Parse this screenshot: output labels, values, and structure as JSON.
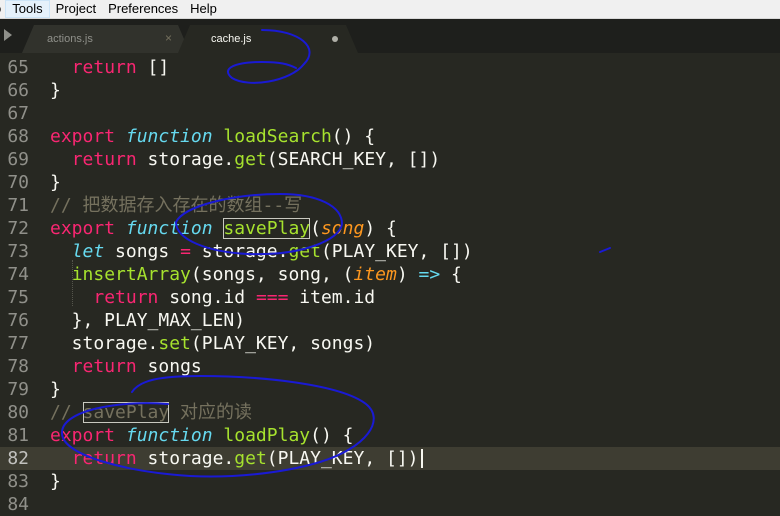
{
  "menu": {
    "items": [
      {
        "label": "o"
      },
      {
        "label": "Tools"
      },
      {
        "label": "Project"
      },
      {
        "label": "Preferences"
      },
      {
        "label": "Help"
      }
    ]
  },
  "tabs": [
    {
      "label": "actions.js",
      "close_glyph": "×"
    },
    {
      "label": "cache.js"
    }
  ],
  "editor": {
    "lines": [
      {
        "num": "65",
        "segments": [
          {
            "t": "  "
          },
          {
            "t": "return",
            "c": "kw"
          },
          {
            "t": " []"
          }
        ]
      },
      {
        "num": "66",
        "segments": [
          {
            "t": "}"
          }
        ]
      },
      {
        "num": "67",
        "segments": []
      },
      {
        "num": "68",
        "segments": [
          {
            "t": "export",
            "c": "kw"
          },
          {
            "t": " "
          },
          {
            "t": "function",
            "c": "st"
          },
          {
            "t": " "
          },
          {
            "t": "loadSearch",
            "c": "fn"
          },
          {
            "t": "() {"
          }
        ]
      },
      {
        "num": "69",
        "segments": [
          {
            "t": "  "
          },
          {
            "t": "return",
            "c": "kw"
          },
          {
            "t": " storage."
          },
          {
            "t": "get",
            "c": "fn"
          },
          {
            "t": "(SEARCH_KEY, [])"
          }
        ]
      },
      {
        "num": "70",
        "segments": [
          {
            "t": "}"
          }
        ]
      },
      {
        "num": "71",
        "segments": [
          {
            "t": "// 把数据存入存在的数组--写",
            "c": "cm"
          }
        ]
      },
      {
        "num": "72",
        "segments": [
          {
            "t": "export",
            "c": "kw"
          },
          {
            "t": " "
          },
          {
            "t": "function",
            "c": "st"
          },
          {
            "t": " "
          },
          {
            "t": "savePlay",
            "c": "fn hl"
          },
          {
            "t": "("
          },
          {
            "t": "song",
            "c": "pa"
          },
          {
            "t": ") {"
          }
        ]
      },
      {
        "num": "73",
        "segments": [
          {
            "t": "  "
          },
          {
            "t": "let",
            "c": "st"
          },
          {
            "t": " songs "
          },
          {
            "t": "=",
            "c": "kw"
          },
          {
            "t": " storage."
          },
          {
            "t": "get",
            "c": "fn"
          },
          {
            "t": "(PLAY_KEY, [])"
          }
        ]
      },
      {
        "num": "74",
        "segments": [
          {
            "t": "  "
          },
          {
            "t": "insertArray",
            "c": "fn"
          },
          {
            "t": "(songs, song, ("
          },
          {
            "t": "item",
            "c": "pa"
          },
          {
            "t": ") "
          },
          {
            "t": "=>",
            "c": "st"
          },
          {
            "t": " {"
          }
        ]
      },
      {
        "num": "75",
        "segments": [
          {
            "t": "    "
          },
          {
            "t": "return",
            "c": "kw"
          },
          {
            "t": " song.id "
          },
          {
            "t": "===",
            "c": "kw"
          },
          {
            "t": " item.id"
          }
        ]
      },
      {
        "num": "76",
        "segments": [
          {
            "t": "  }, PLAY_MAX_LEN)"
          }
        ]
      },
      {
        "num": "77",
        "segments": [
          {
            "t": "  storage."
          },
          {
            "t": "set",
            "c": "fn"
          },
          {
            "t": "(PLAY_KEY, songs)"
          }
        ]
      },
      {
        "num": "78",
        "segments": [
          {
            "t": "  "
          },
          {
            "t": "return",
            "c": "kw"
          },
          {
            "t": " songs"
          }
        ]
      },
      {
        "num": "79",
        "segments": [
          {
            "t": "}"
          }
        ]
      },
      {
        "num": "80",
        "segments": [
          {
            "t": "// ",
            "c": "cm"
          },
          {
            "t": "savePlay",
            "c": "cm hl"
          },
          {
            "t": " 对应的读",
            "c": "cm"
          }
        ]
      },
      {
        "num": "81",
        "segments": [
          {
            "t": "export",
            "c": "kw"
          },
          {
            "t": " "
          },
          {
            "t": "function",
            "c": "st"
          },
          {
            "t": " "
          },
          {
            "t": "loadPlay",
            "c": "fn"
          },
          {
            "t": "() {"
          }
        ]
      },
      {
        "num": "82",
        "current": true,
        "segments": [
          {
            "t": "  "
          },
          {
            "t": "return",
            "c": "kw"
          },
          {
            "t": " storage."
          },
          {
            "t": "get",
            "c": "fn"
          },
          {
            "t": "(PLAY_KEY, [])"
          }
        ]
      },
      {
        "num": "83",
        "segments": [
          {
            "t": "}"
          }
        ]
      },
      {
        "num": "84",
        "segments": []
      }
    ]
  },
  "colors": {
    "background": "#272822",
    "keyword": "#f92672",
    "storage": "#66d9ef",
    "function": "#a6e22e",
    "parameter": "#fd971f",
    "comment": "#75715e",
    "annotation_ink": "#1a1ad4"
  }
}
